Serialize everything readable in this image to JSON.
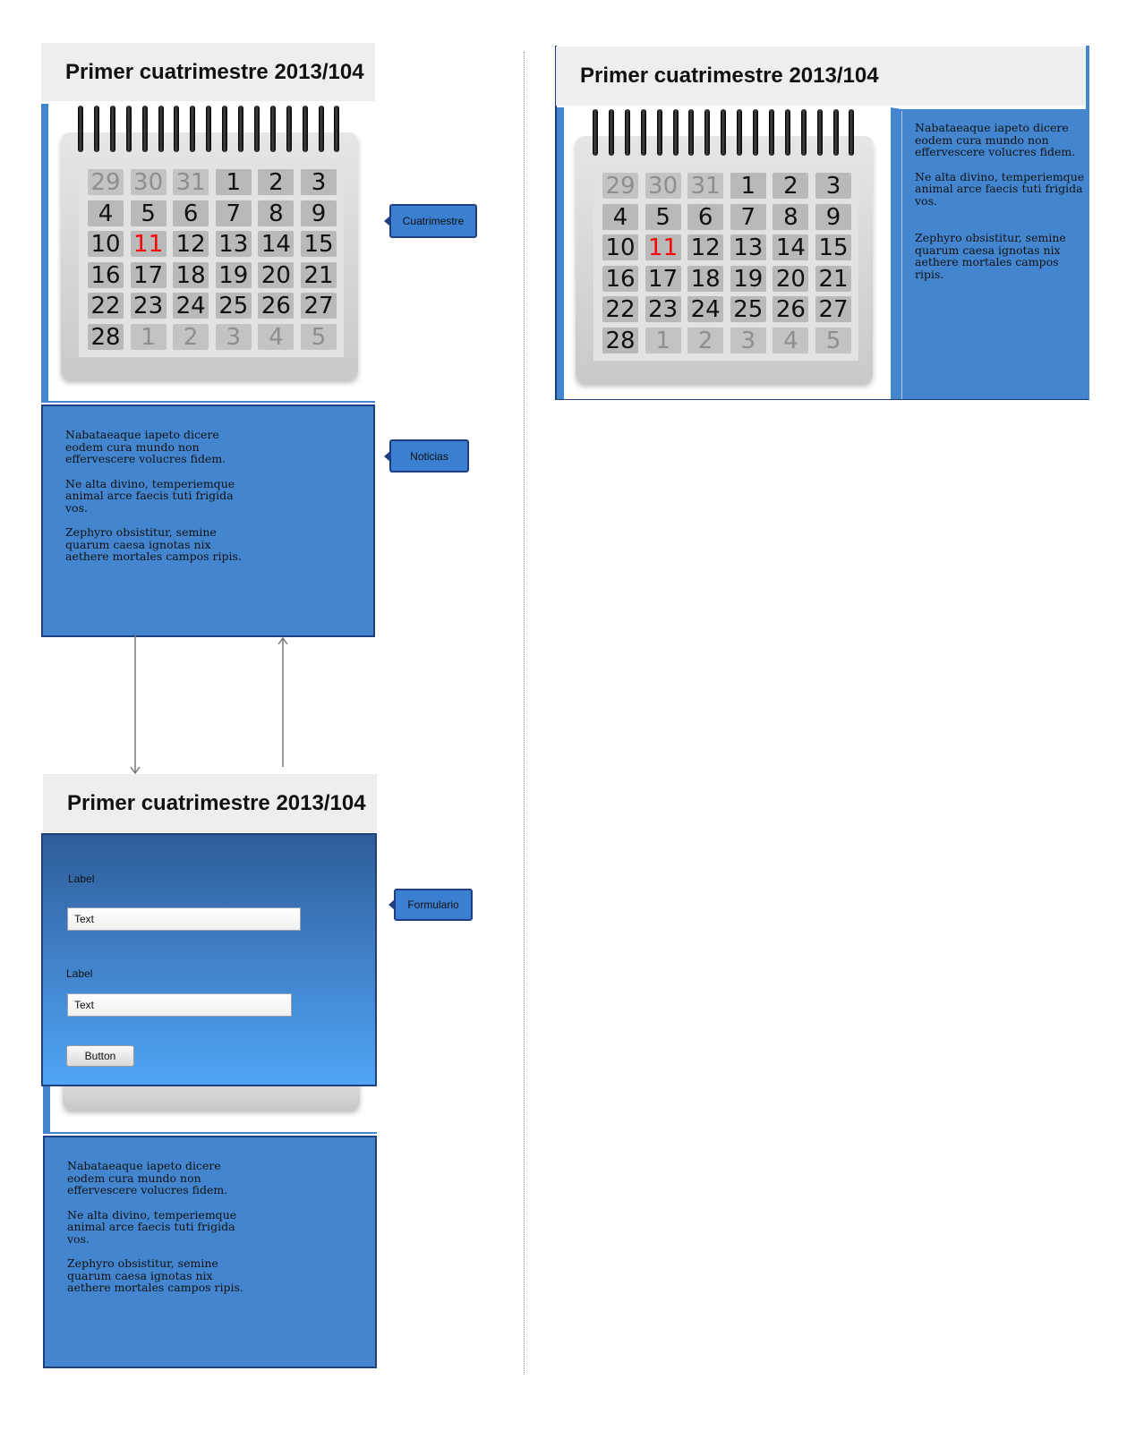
{
  "title": "Primer cuatrimestre 2013/104",
  "calendar": {
    "rows": [
      [
        {
          "d": "29",
          "state": "muted"
        },
        {
          "d": "30",
          "state": "muted"
        },
        {
          "d": "31",
          "state": "muted"
        },
        {
          "d": "1",
          "state": "normal"
        },
        {
          "d": "2",
          "state": "normal"
        },
        {
          "d": "3",
          "state": "normal"
        }
      ],
      [
        {
          "d": "4",
          "state": "normal"
        },
        {
          "d": "5",
          "state": "normal"
        },
        {
          "d": "6",
          "state": "normal"
        },
        {
          "d": "7",
          "state": "normal"
        },
        {
          "d": "8",
          "state": "normal"
        },
        {
          "d": "9",
          "state": "normal"
        }
      ],
      [
        {
          "d": "10",
          "state": "normal"
        },
        {
          "d": "11",
          "state": "today"
        },
        {
          "d": "12",
          "state": "normal"
        },
        {
          "d": "13",
          "state": "normal"
        },
        {
          "d": "14",
          "state": "normal"
        },
        {
          "d": "15",
          "state": "normal"
        }
      ],
      [
        {
          "d": "16",
          "state": "normal"
        },
        {
          "d": "17",
          "state": "normal"
        },
        {
          "d": "18",
          "state": "normal"
        },
        {
          "d": "19",
          "state": "normal"
        },
        {
          "d": "20",
          "state": "normal"
        },
        {
          "d": "21",
          "state": "normal"
        }
      ],
      [
        {
          "d": "22",
          "state": "normal"
        },
        {
          "d": "23",
          "state": "normal"
        },
        {
          "d": "24",
          "state": "normal"
        },
        {
          "d": "25",
          "state": "normal"
        },
        {
          "d": "26",
          "state": "normal"
        },
        {
          "d": "27",
          "state": "normal"
        }
      ],
      [
        {
          "d": "28",
          "state": "normal"
        },
        {
          "d": "1",
          "state": "muted"
        },
        {
          "d": "2",
          "state": "muted"
        },
        {
          "d": "3",
          "state": "muted"
        },
        {
          "d": "4",
          "state": "muted"
        },
        {
          "d": "5",
          "state": "muted"
        }
      ]
    ]
  },
  "news": {
    "p1": "Nabataeaque iapeto dicere\neodem cura mundo non\neffervescere volucres fidem.",
    "p2": "Ne alta divino, temperiemque\nanimal arce faecis tuti frigida\nvos.",
    "p3": "Zephyro obsistitur, semine\nquarum caesa ignotas nix\naethere mortales campos ripis."
  },
  "callouts": {
    "cuatrimestre": "Cuatrimestre",
    "noticias": "Noticias",
    "formulario": "Formulario"
  },
  "form": {
    "label1": "Label",
    "input1": "Text",
    "label2": "Label",
    "input2": "Text",
    "button": "Button"
  },
  "colors": {
    "panel": "#4386cf",
    "border": "#1f3f80",
    "today": "#ff0000",
    "titlebar": "#eeeeee"
  }
}
